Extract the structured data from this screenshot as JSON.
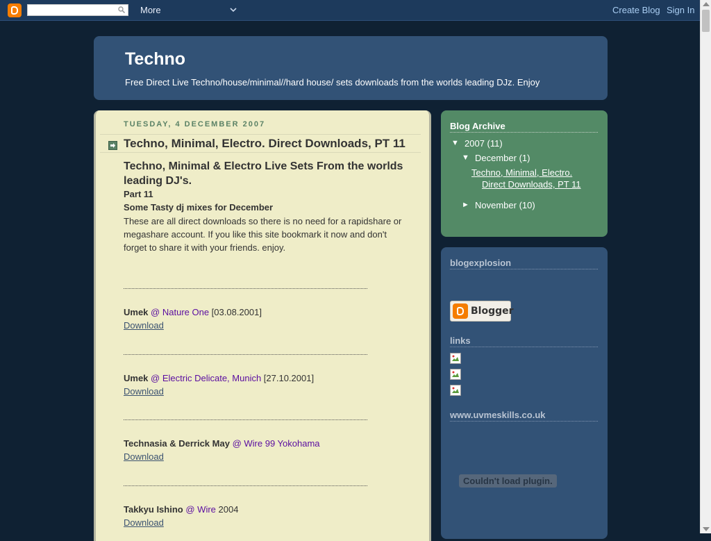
{
  "navbar": {
    "search_placeholder": "",
    "more": "More",
    "create_blog": "Create Blog",
    "sign_in": "Sign In"
  },
  "header": {
    "title": "Techno",
    "description": "Free Direct Live Techno/house/minimal//hard house/ sets downloads from the worlds leading DJz. Enjoy"
  },
  "post": {
    "date": "Tuesday, 4 December 2007",
    "title": "Techno, Minimal, Electro. Direct Downloads, PT 11",
    "heading": "Techno, Minimal & Electro Live Sets From the worlds leading DJ's.",
    "part": "Part 11",
    "subheading": "Some Tasty dj mixes for December",
    "body": "These are all direct downloads so there is no need for a rapidshare or megashare account. If you like this site bookmark it now and don't forget to share it with your friends. enjoy.",
    "entries": [
      {
        "artist": "Umek",
        "venue": "@ Nature One",
        "date": " [03.08.2001]",
        "download": "Download"
      },
      {
        "artist": "Umek",
        "venue": "@ Electric Delicate, Munich",
        "date": " [27.10.2001]",
        "download": "Download"
      },
      {
        "artist": "Technasia & Derrick May",
        "venue": "@ Wire 99 Yokohama",
        "date": "",
        "download": "Download"
      },
      {
        "artist": "Takkyu Ishino",
        "venue": "@ Wire",
        "date": " 2004",
        "download": "Download"
      }
    ]
  },
  "sidebar": {
    "archive_title": "Blog Archive",
    "year": "2007",
    "year_count": "(11)",
    "december": "December",
    "december_count": "(1)",
    "december_post_line1": "Techno, Minimal, Electro.",
    "december_post_line2": "Direct Downloads, PT 11",
    "november": "November",
    "november_count": "(10)",
    "blogexplosion_title": "blogexplosion",
    "blogger_badge": "Blogger",
    "links_title": "links",
    "uvmeskills_title": "www.uvmeskills.co.uk",
    "plugin_message": "Couldn't load plugin."
  },
  "colors": {
    "background": "#0f2133",
    "header": "#325276",
    "post_bg": "#efedc8",
    "archive_bg": "#538a66",
    "venue_link": "#5a0da0"
  }
}
